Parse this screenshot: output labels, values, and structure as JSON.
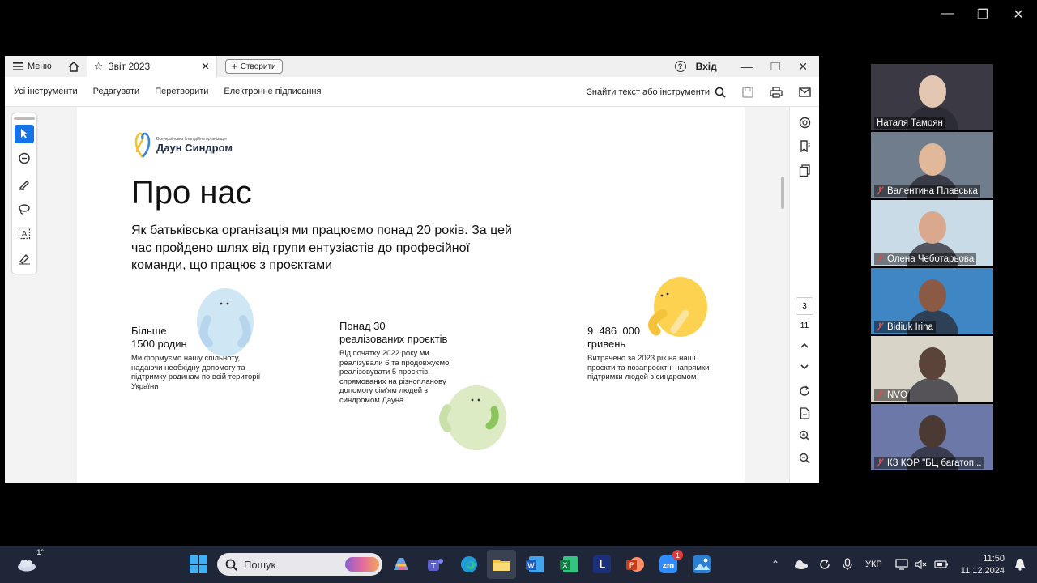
{
  "window": {
    "menu_label": "Меню",
    "tab_title": "Звіт 2023",
    "create_label": "Створити",
    "signin_label": "Вхід"
  },
  "toolbar": {
    "items": [
      "Усі інструменти",
      "Редагувати",
      "Перетворити",
      "Електронне підписання"
    ],
    "search_label": "Знайти текст або інструменти"
  },
  "document": {
    "logo_small": "Всеукраїнська благодійна організація",
    "logo_big": "Даун Синдром",
    "title": "Про нас",
    "intro": "Як батьківська організація ми працюємо понад 20 років.  За цей час пройдено шлях від групи ентузіастів до професійної команди, що працює з проєктами",
    "stats": [
      {
        "l1": "Більше",
        "l2": "1500 родин",
        "desc": "Ми формуємо нашу спільноту, надаючи  необхідну допомогу та підтримку родинам по всій території України"
      },
      {
        "l1": "Понад 30",
        "l2": "реалізованих проєктів",
        "desc": "Від початку 2022 року ми реалізували 6 та продовжуємо реалізовувати 5 проєктів, спрямованих на різнопланову допомогу сім'ям людей з синдромом Дауна"
      },
      {
        "l1": "9  486  000",
        "l2": "гривень",
        "desc": "Витрачено за 2023 рік на наші проєкти та позапроєктні напрямки підтримки людей з синдромом"
      }
    ]
  },
  "pager": {
    "current": "3",
    "total": "11"
  },
  "participants": [
    {
      "name": "Наталя Тамоян",
      "muted": false,
      "bg": "#3b3a44",
      "face": "#e4c7b3"
    },
    {
      "name": "Валентина Плавська",
      "muted": true,
      "bg": "#6f7d8c",
      "face": "#e1b99a"
    },
    {
      "name": "Олена Чеботарьова",
      "muted": true,
      "bg": "#c9dbe6",
      "face": "#d9a88d"
    },
    {
      "name": "Bidiuk Irina",
      "muted": true,
      "bg": "#3e86c4",
      "face": "#8a5a44"
    },
    {
      "name": "NVO",
      "muted": true,
      "bg": "#d9d4c8",
      "face": "#5a4338"
    },
    {
      "name": "КЗ КОР \"БЦ багатоп...",
      "muted": true,
      "bg": "#6b78a8",
      "face": "#4a3a33"
    }
  ],
  "taskbar": {
    "weather": "1°",
    "search_placeholder": "Пошук",
    "lang": "УКР",
    "time": "11:50",
    "date": "11.12.2024",
    "zoom_badge": "1"
  },
  "colors": {
    "accent": "#1473e6",
    "active_speaker": "#2bd36b",
    "taskbar": "#1f2637"
  }
}
